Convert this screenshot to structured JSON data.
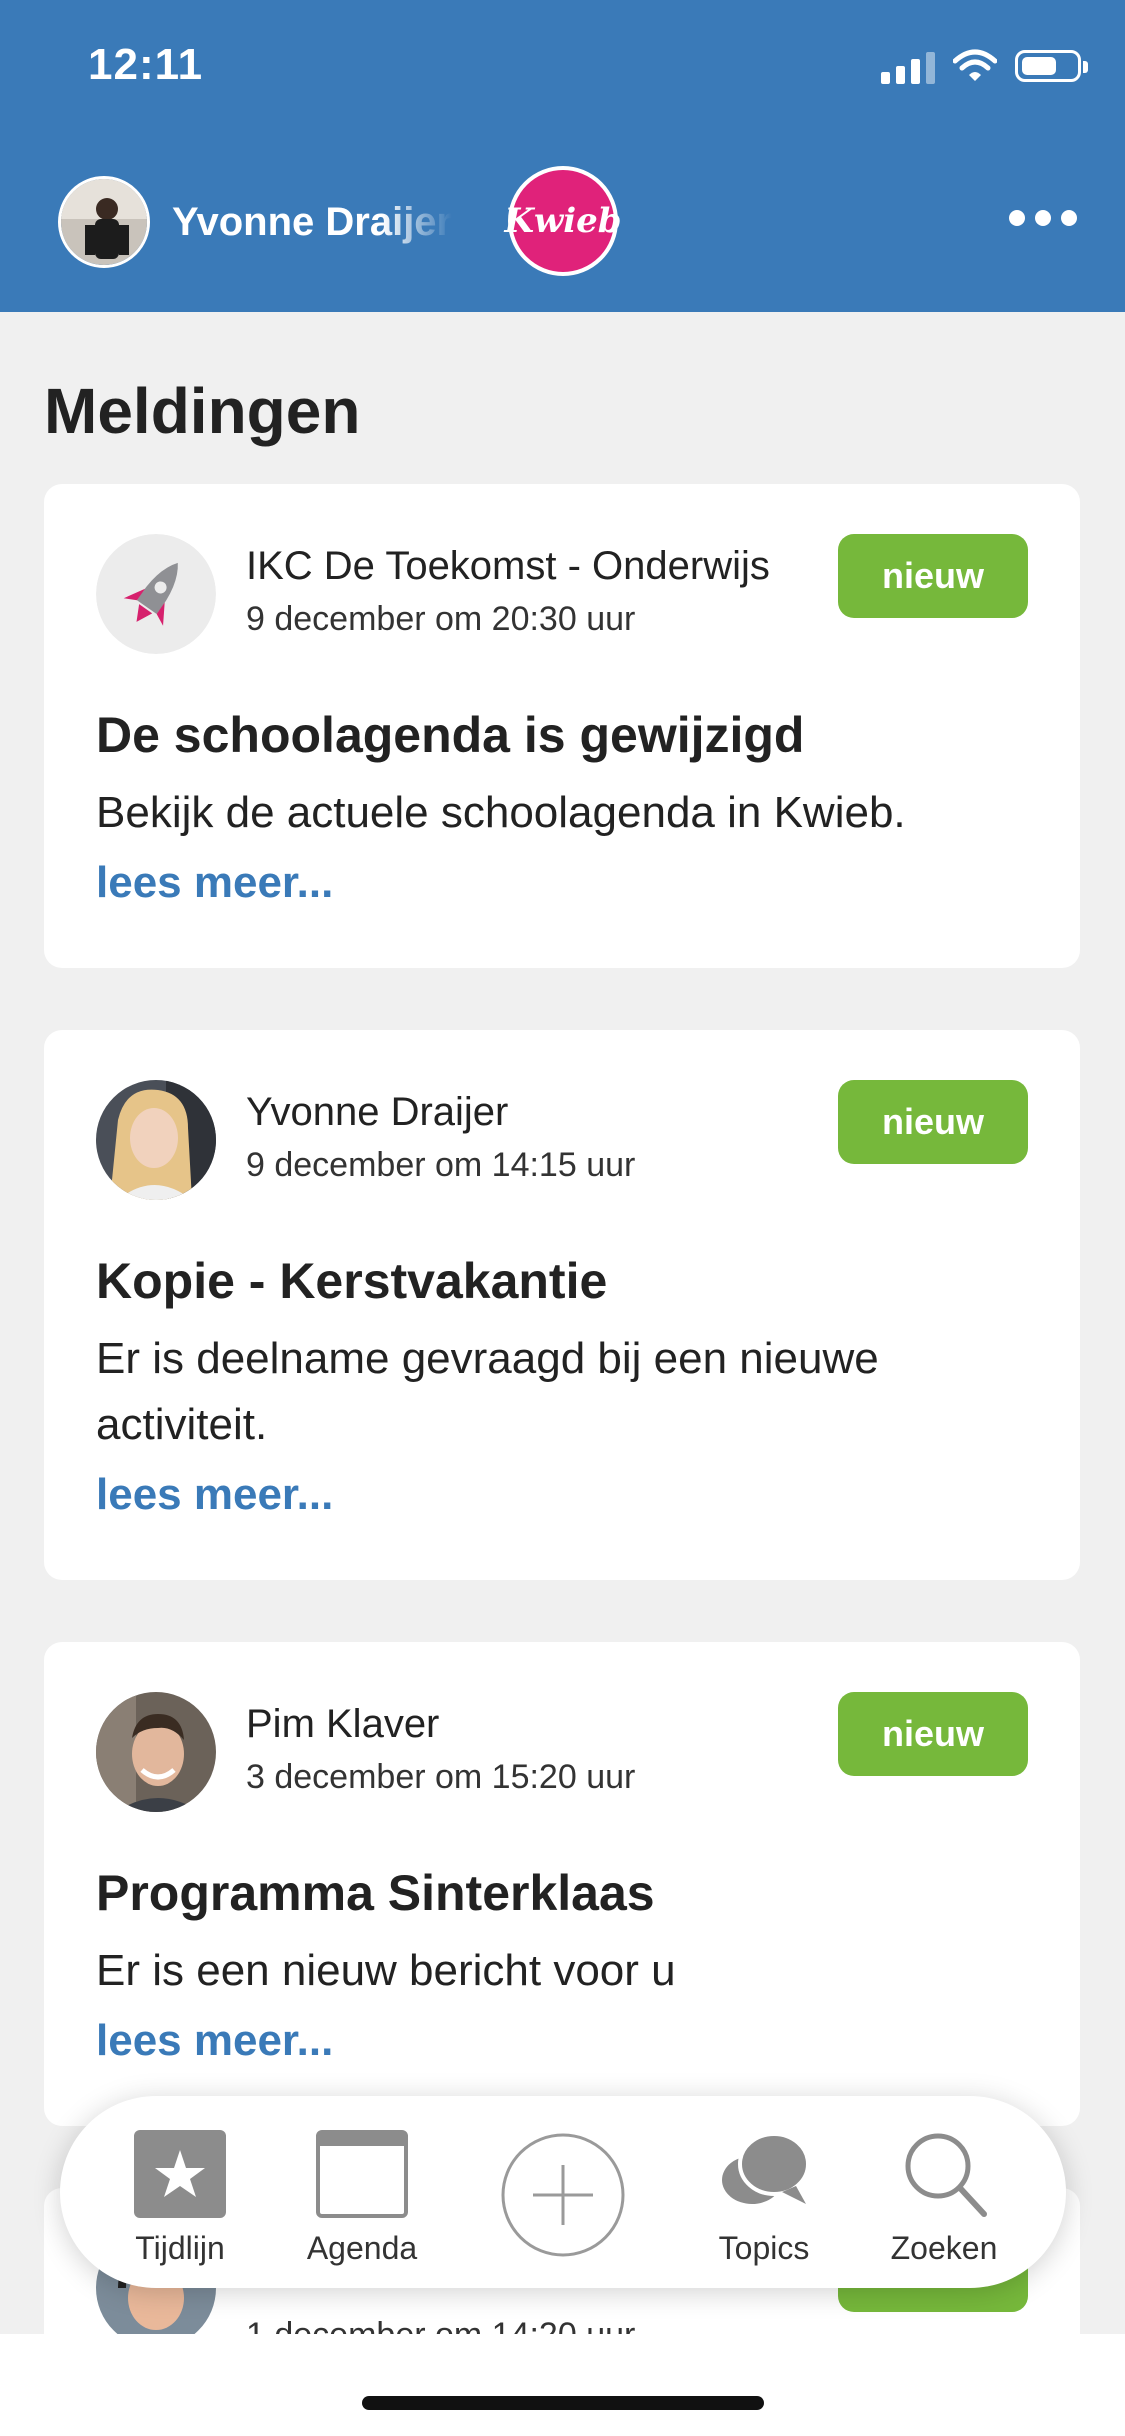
{
  "status_bar": {
    "time": "12:11"
  },
  "header": {
    "user_name": "Yvonne Draijer",
    "brand_logo": "Kwieb",
    "colors": {
      "header_bg": "#3a7ab8",
      "brand": "#e0227a"
    }
  },
  "page": {
    "title": "Meldingen"
  },
  "notifications": [
    {
      "sender": "IKC De Toekomst - Onderwijs",
      "date": "9 december om 20:30 uur",
      "badge": "nieuw",
      "title": "De schoolagenda is gewijzigd",
      "body": "Bekijk de actuele schoolagenda in Kwieb.",
      "link": "lees meer..."
    },
    {
      "sender": "Yvonne Draijer",
      "date": "9 december om 14:15 uur",
      "badge": "nieuw",
      "title": "Kopie - Kerstvakantie",
      "body": "Er is deelname gevraagd bij een nieuwe activiteit.",
      "link": "lees meer..."
    },
    {
      "sender": "Pim Klaver",
      "date": "3 december om 15:20 uur",
      "badge": "nieuw",
      "title": "Programma Sinterklaas",
      "body": "Er is een nieuw bericht voor u",
      "link": "lees meer..."
    },
    {
      "date": "1 december om 14:20 uur",
      "badge": "nieuw"
    }
  ],
  "tabbar": {
    "tabs": [
      {
        "label": "Tijdlijn",
        "icon": "star-icon"
      },
      {
        "label": "Agenda",
        "icon": "calendar-icon"
      },
      {
        "label": "",
        "icon": "plus-icon"
      },
      {
        "label": "Topics",
        "icon": "chat-bubbles-icon"
      },
      {
        "label": "Zoeken",
        "icon": "search-icon"
      }
    ]
  },
  "colors": {
    "badge_green": "#76b83b",
    "link_blue": "#3a7ab8"
  }
}
